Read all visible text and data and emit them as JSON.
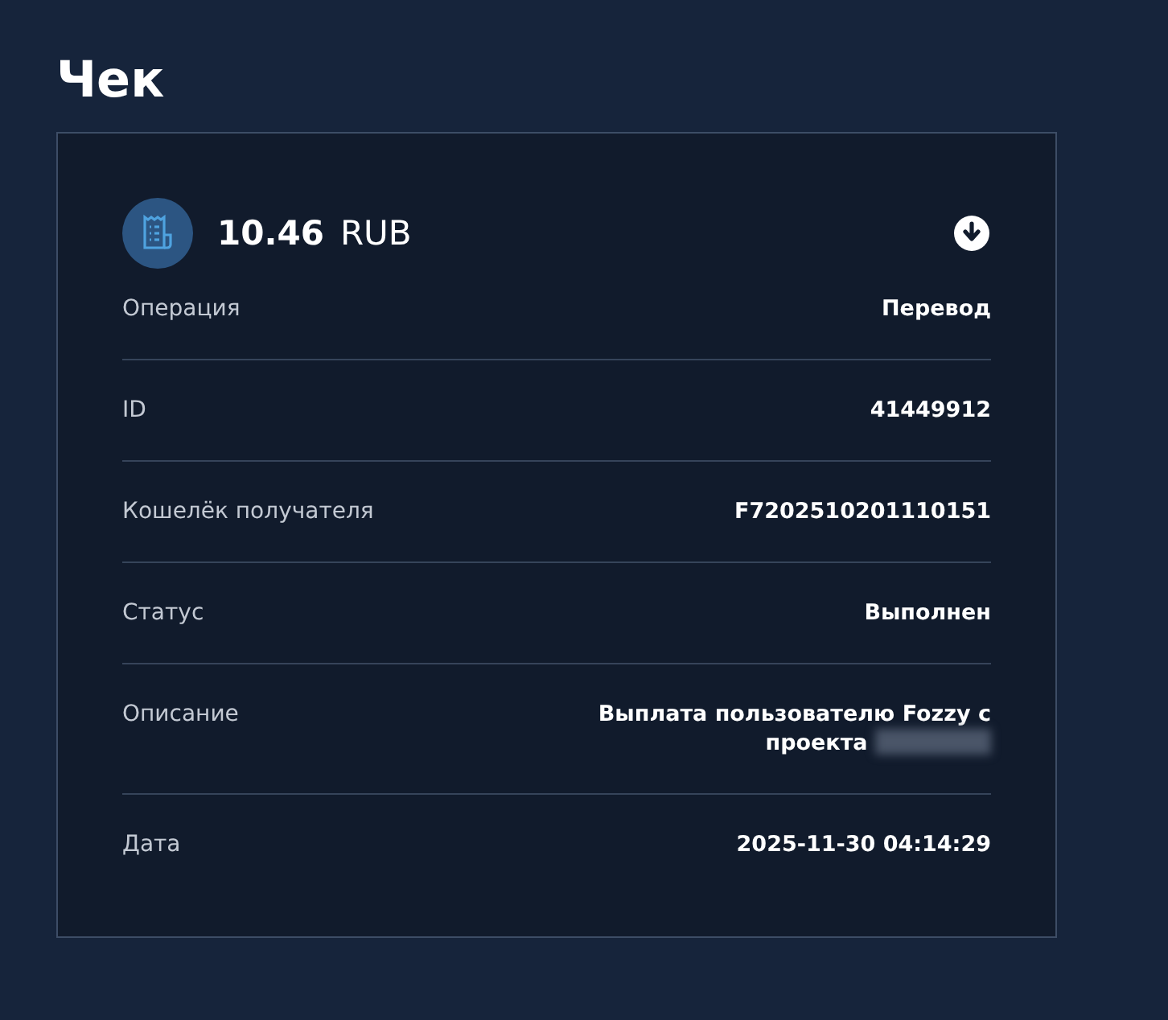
{
  "title": "Чек",
  "receipt": {
    "amount": "10.46",
    "currency": "RUB",
    "rows": [
      {
        "label": "Операция",
        "value": "Перевод"
      },
      {
        "label": "ID",
        "value": "41449912"
      },
      {
        "label": "Кошелёк получателя",
        "value": "F7202510201110151"
      },
      {
        "label": "Статус",
        "value": "Выполнен"
      },
      {
        "label": "Описание",
        "value": "Выплата пользователю Fozzy с проекта",
        "redacted": true
      },
      {
        "label": "Дата",
        "value": "2025-11-30 04:14:29"
      }
    ]
  }
}
